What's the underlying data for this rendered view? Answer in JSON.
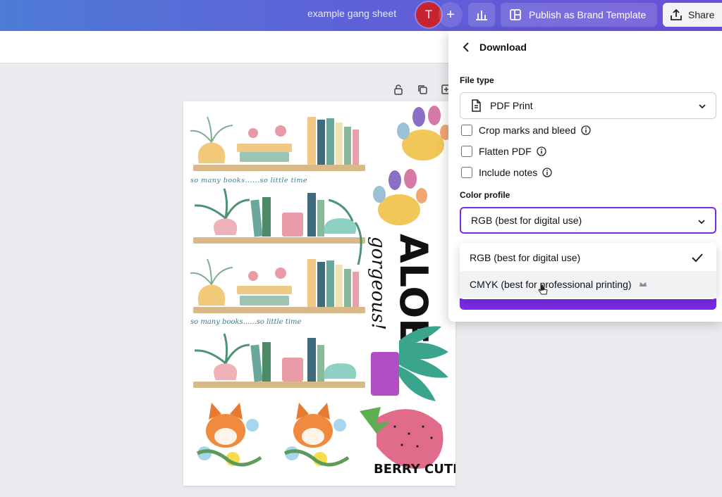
{
  "topbar": {
    "doc_title": "example gang sheet",
    "avatar_initial": "T",
    "add_label": "+",
    "publish_label": "Publish as Brand Template",
    "share_label": "Share"
  },
  "design": {
    "caption_text": "so many books......so little time",
    "aloe_word": "ALOE",
    "gorgeous_word": "gorgeous!",
    "berry_text": "BERRY CUTE"
  },
  "download_panel": {
    "title": "Download",
    "file_type_label": "File type",
    "file_type_value": "PDF Print",
    "options": [
      {
        "label": "Crop marks and bleed"
      },
      {
        "label": "Flatten PDF"
      },
      {
        "label": "Include notes"
      }
    ],
    "color_profile_label": "Color profile",
    "color_profile_value": "RGB (best for digital use)",
    "dropdown_options": [
      {
        "label": "RGB (best for digital use)",
        "selected": true
      },
      {
        "label": "CMYK (best for professional printing)",
        "selected": false,
        "premium": true
      }
    ],
    "accent_color": "#7d2ae8"
  }
}
